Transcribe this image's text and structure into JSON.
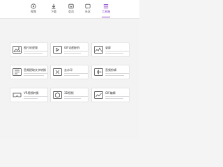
{
  "nav": {
    "items": [
      {
        "label": "视频",
        "icon": "video-play-icon",
        "active": false
      },
      {
        "label": "下载",
        "icon": "download-icon",
        "active": false
      },
      {
        "label": "会员",
        "icon": "vip-icon",
        "active": false
      },
      {
        "label": "社区",
        "icon": "community-icon",
        "active": false
      },
      {
        "label": "工具箱",
        "icon": "toolbox-icon",
        "active": true
      }
    ],
    "accent": "#8e44c7"
  },
  "tools": [
    {
      "title": "图片转视频",
      "icon": "photo-to-video-icon"
    },
    {
      "title": "GIF动图制作",
      "icon": "gif-maker-icon"
    },
    {
      "title": "录屏",
      "icon": "screen-record-icon"
    },
    {
      "title": "音频提取文字转换",
      "icon": "audio-to-text-icon"
    },
    {
      "title": "去水印",
      "icon": "remove-watermark-icon"
    },
    {
      "title": "音频剪辑",
      "icon": "audio-edit-icon"
    },
    {
      "title": "VR视频转换",
      "icon": "vr-convert-icon"
    },
    {
      "title": "3D视频",
      "icon": "3d-video-icon"
    },
    {
      "title": "GIF编辑",
      "icon": "gif-edit-icon"
    }
  ]
}
